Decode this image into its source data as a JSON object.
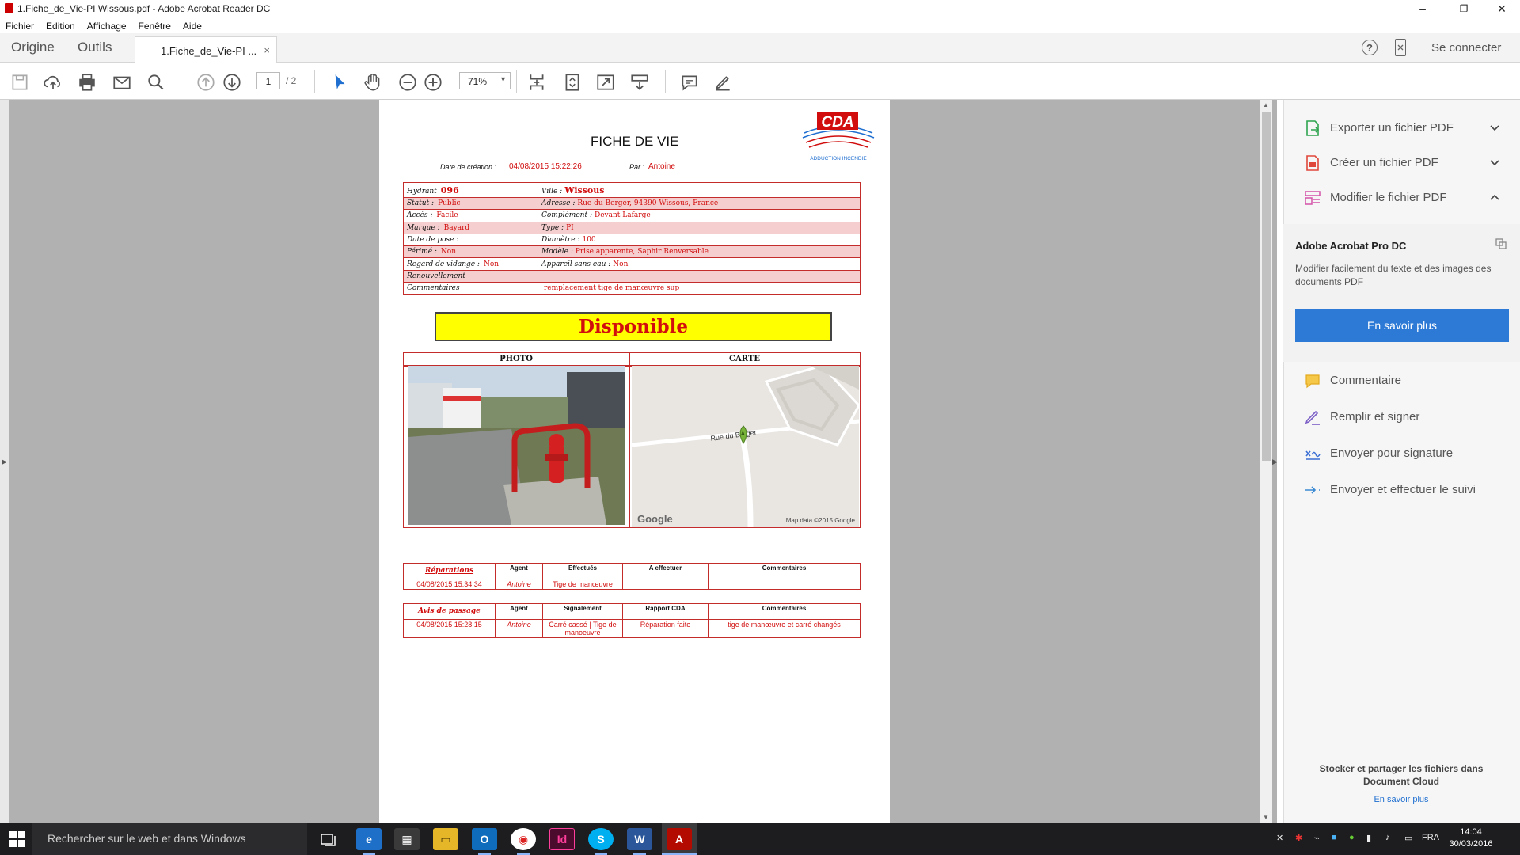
{
  "window": {
    "title": "1.Fiche_de_Vie-PI Wissous.pdf - Adobe Acrobat Reader DC",
    "minimize": "–",
    "restore": "❐",
    "close": "✕"
  },
  "menu": [
    "Fichier",
    "Edition",
    "Affichage",
    "Fenêtre",
    "Aide"
  ],
  "tabs": {
    "home": "Origine",
    "tools": "Outils",
    "doc": "1.Fiche_de_Vie-PI ...",
    "close": "×"
  },
  "header": {
    "help": "?",
    "signin": "Se connecter"
  },
  "toolbar": {
    "page_current": "1",
    "page_total": "/ 2",
    "zoom": "71%"
  },
  "document": {
    "title": "FICHE DE VIE",
    "date_label": "Date de création :",
    "date_value": "04/08/2015 15:22:26",
    "by_label": "Par :",
    "by_value": "Antoine",
    "logo_text": "CDA",
    "logo_sub": "ADDUCTION INCENDIE",
    "info_rows": [
      {
        "l1": "Hydrant",
        "v1": "096",
        "l2": "Ville :",
        "v2": "Wissous"
      },
      {
        "l1": "Statut :",
        "v1": "Public",
        "l2": "Adresse :",
        "v2": "Rue du Berger, 94390 Wissous, France"
      },
      {
        "l1": "Accès :",
        "v1": "Facile",
        "l2": "Complément :",
        "v2": "Devant Lafarge"
      },
      {
        "l1": "Marque :",
        "v1": "Bayard",
        "l2": "Type :",
        "v2": "PI"
      },
      {
        "l1": "Date de pose :",
        "v1": "",
        "l2": "Diamètre :",
        "v2": "100"
      },
      {
        "l1": "Périmé :",
        "v1": "Non",
        "l2": "Modèle :",
        "v2": "Prise apparente, Saphir Renversable"
      },
      {
        "l1": "Regard de vidange :",
        "v1": "Non",
        "l2": "Appareil sans eau :",
        "v2": "Non"
      },
      {
        "l1": "Renouvellement",
        "v1": "",
        "l2": "",
        "v2": ""
      },
      {
        "l1": "Commentaires",
        "v1": "",
        "l2": "",
        "v2": "remplacement tige de manœuvre sup"
      }
    ],
    "status": "Disponible",
    "photo_header": "PHOTO",
    "map_header": "CARTE",
    "map": {
      "street": "Rue du Berger",
      "marker": "A",
      "google": "Google",
      "credit": "Map data ©2015 Google"
    },
    "repairs": {
      "headers": [
        "Réparations",
        "Agent",
        "Effectués",
        "A effectuer",
        "Commentaires"
      ],
      "row": [
        "04/08/2015 15:34:34",
        "Antoine",
        "Tige de manœuvre",
        "",
        ""
      ]
    },
    "visits": {
      "headers": [
        "Avis de passage",
        "Agent",
        "Signalement",
        "Rapport CDA",
        "Commentaires"
      ],
      "row": [
        "04/08/2015 15:28:15",
        "Antoine",
        "Carré cassé | Tige de manoeuvre",
        "Réparation faite",
        "tige de manœuvre et carré changés"
      ]
    }
  },
  "panel": {
    "items_top": [
      "Exporter un fichier PDF",
      "Créer un fichier PDF",
      "Modifier le fichier PDF"
    ],
    "pro_title": "Adobe Acrobat Pro DC",
    "pro_desc": "Modifier facilement du texte et des images des documents PDF",
    "pro_button": "En savoir plus",
    "items_bottom": [
      "Commentaire",
      "Remplir et signer",
      "Envoyer pour signature",
      "Envoyer et effectuer le suivi"
    ],
    "cloud_text": "Stocker et partager les fichiers dans Document Cloud",
    "cloud_link": "En savoir plus"
  },
  "taskbar": {
    "search": "Rechercher sur le web et dans Windows",
    "lang": "FRA",
    "time": "14:04",
    "date": "30/03/2016"
  }
}
